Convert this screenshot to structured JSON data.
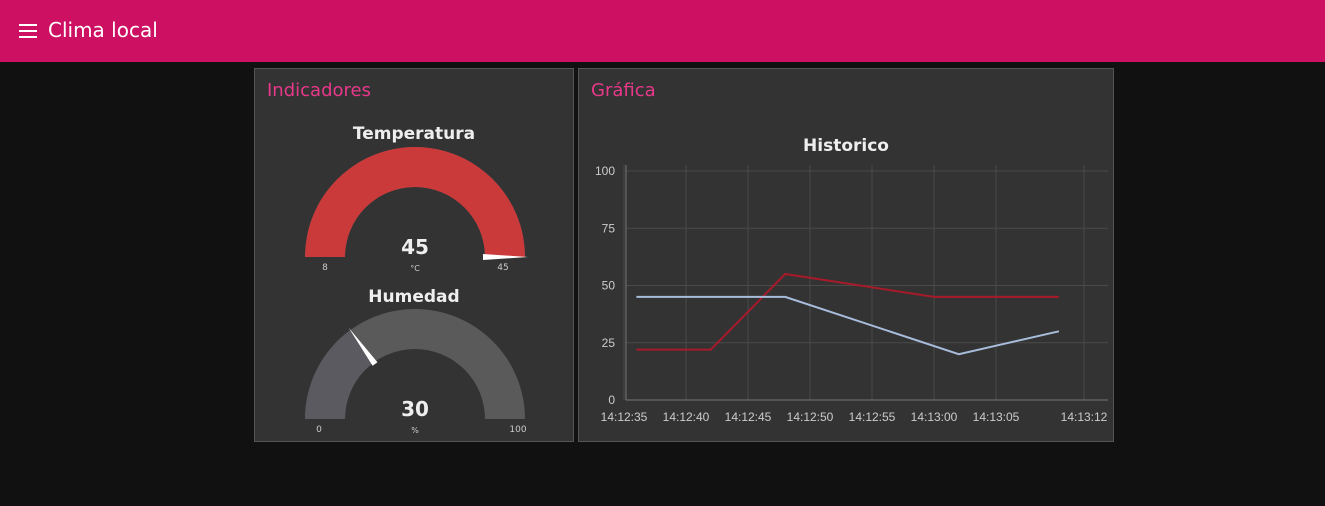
{
  "header": {
    "title": "Clima local",
    "menu_icon": "menu-icon",
    "background": "#cd1062"
  },
  "indicators_card": {
    "title": "Indicadores",
    "gauges": [
      {
        "label": "Temperatura",
        "value": "45",
        "unit": "°C",
        "min": "8",
        "max": "45",
        "level": 1.0,
        "color": "#cb3a3a"
      },
      {
        "label": "Humedad",
        "value": "30",
        "unit": "%",
        "min": "0",
        "max": "100",
        "level": 0.3,
        "color": "#5a5a60"
      }
    ]
  },
  "chart_card": {
    "title": "Gráfica"
  },
  "chart_data": {
    "type": "line",
    "title": "Historico",
    "xlabel": "",
    "ylabel": "",
    "ylim": [
      0,
      100
    ],
    "y_ticks": [
      "0",
      "25",
      "50",
      "75",
      "100"
    ],
    "x_ticks": [
      "14:12:35",
      "14:12:40",
      "14:12:45",
      "14:12:50",
      "14:12:55",
      "14:13:00",
      "14:13:05",
      "14:13:12"
    ],
    "grid": true,
    "legend": "none",
    "series": [
      {
        "color": "#a71a2a",
        "x": [
          "14:12:36",
          "14:12:42",
          "14:12:48",
          "14:13:00",
          "14:13:10"
        ],
        "values": [
          22,
          22,
          55,
          45,
          45
        ]
      },
      {
        "color": "#a8bddb",
        "x": [
          "14:12:36",
          "14:12:48",
          "14:13:02",
          "14:13:10"
        ],
        "values": [
          45,
          45,
          20,
          30
        ]
      }
    ]
  }
}
